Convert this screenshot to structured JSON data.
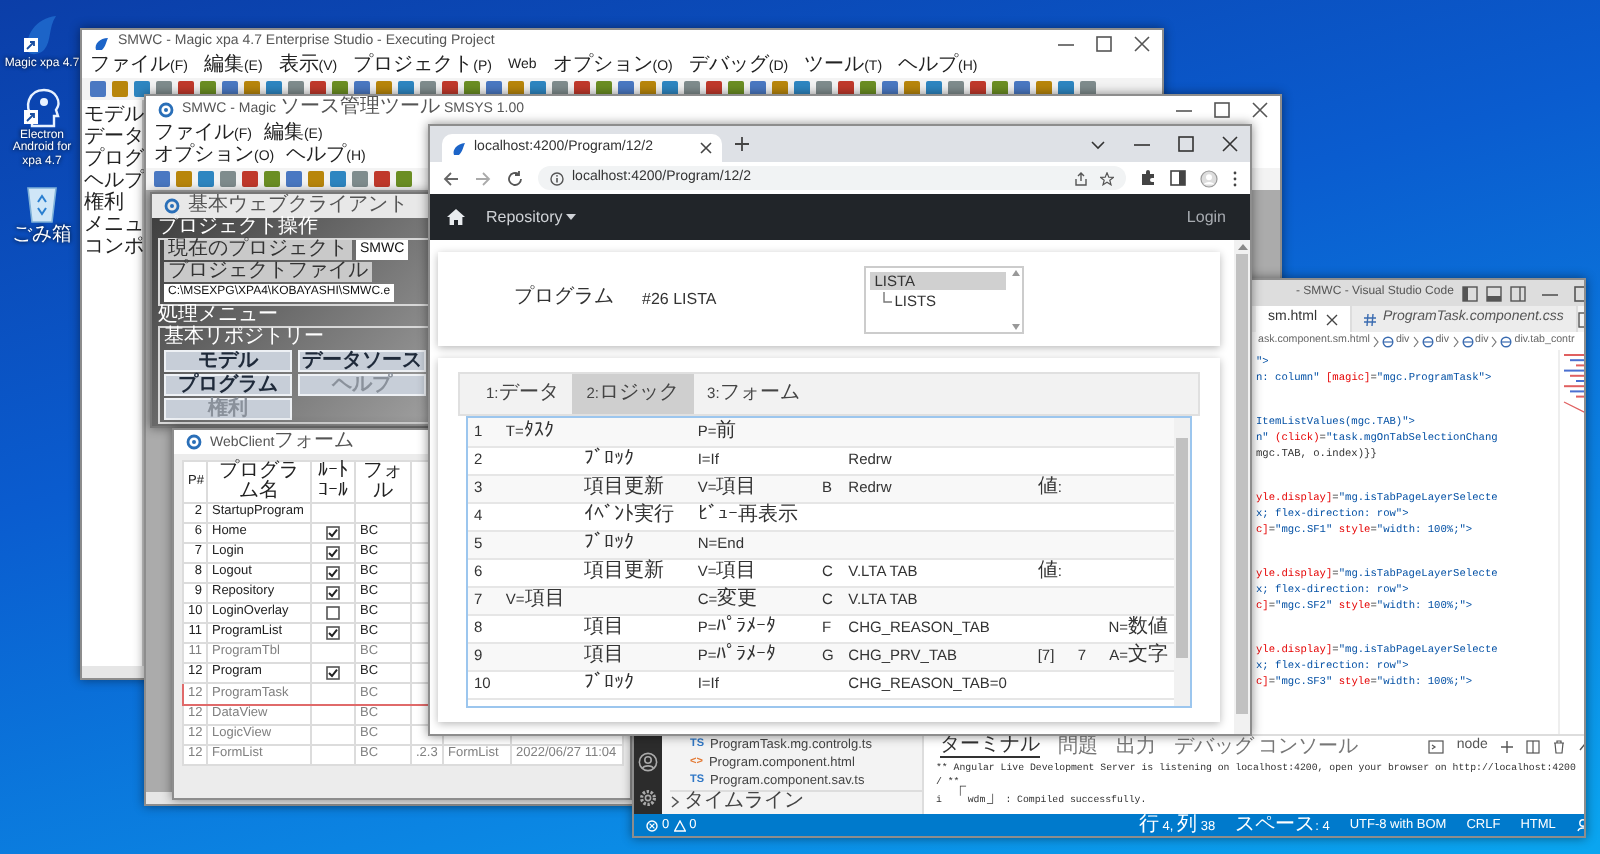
{
  "desktop_icons": [
    {
      "label": "Magic xpa 4.7",
      "kind": "app"
    },
    {
      "label": "Electron Android for xpa 4.7",
      "kind": "person"
    },
    {
      "label": "ごみ箱",
      "kind": "bin"
    }
  ],
  "magic_window": {
    "title": "SMWC - Magic xpa 4.7 Enterprise Studio - Executing Project",
    "menu": [
      "ファイル(F)",
      "編集(E)",
      "表示(V)",
      "プロジェクト(P)",
      "Web",
      "オプション(O)",
      "デバッグ(D)",
      "ツール(T)",
      "ヘルプ(H)"
    ],
    "tree_items": [
      "モデル",
      "データ",
      "プログ",
      "ヘルプ",
      "権利",
      "メニュ",
      "コンポ"
    ]
  },
  "smsys_window": {
    "title": "SMWC - Magic ソース管理ツール SMSYS 1.00",
    "menu": [
      "ファイル(F)",
      "編集(E)",
      "オプション(O)",
      "ヘルプ(H)"
    ]
  },
  "client_window": {
    "title": "基本ウェブクライアント",
    "project_group": {
      "legend": "プロジェクト操作",
      "fields": [
        {
          "label": "現在のプロジェクト",
          "value": "SMWC"
        },
        {
          "label": "プロジェクトファイル",
          "value": "C:\\MSEXPG\\XPA4\\KOBAYASHI\\SMWC.e"
        }
      ]
    },
    "menu_group": {
      "legend": "処理メニュー",
      "subgroup": {
        "legend": "基本リポジトリー",
        "buttons": [
          {
            "label": "モデル",
            "disabled": false
          },
          {
            "label": "データソース",
            "disabled": false
          },
          {
            "label": "プログラム",
            "disabled": false
          },
          {
            "label": "ヘルプ",
            "disabled": true
          },
          {
            "label": "権利",
            "disabled": true
          }
        ]
      }
    }
  },
  "webclient_form": {
    "title": "WebClientフォーム",
    "columns": [
      "P#",
      "プログラム名",
      "ﾙｰﾄｺｰﾙ",
      "フォル"
    ],
    "rows": [
      {
        "number": "2",
        "program": "StartupProgram",
        "disabled": false,
        "selected": false
      },
      {
        "number": "6",
        "program": "Home",
        "checked": true,
        "column_4": "BC",
        "disabled": false,
        "selected": false
      },
      {
        "number": "7",
        "program": "Login",
        "checked": true,
        "column_4": "BC",
        "disabled": false,
        "selected": false
      },
      {
        "number": "8",
        "program": "Logout",
        "checked": true,
        "column_4": "BC",
        "disabled": false,
        "selected": false
      },
      {
        "number": "9",
        "program": "Repository",
        "checked": true,
        "column_4": "BC",
        "disabled": false,
        "selected": false
      },
      {
        "number": "10",
        "program": "LoginOverlay",
        "checked": false,
        "column_4": "BC",
        "disabled": false,
        "selected": false
      },
      {
        "number": "11",
        "program": "ProgramList",
        "checked": true,
        "column_4": "BC",
        "disabled": false,
        "selected": false
      },
      {
        "number": "11",
        "program": "ProgramTbl",
        "column_4": "BC",
        "disabled": true,
        "selected": false
      },
      {
        "number": "12",
        "program": "Program",
        "checked": true,
        "column_4": "BC",
        "disabled": false,
        "selected": false
      },
      {
        "number": "12",
        "program": "ProgramTask",
        "column_4": "BC",
        "disabled": true,
        "selected": true
      },
      {
        "number": "12",
        "program": "DataView",
        "column_4": "BC",
        "disabled": true,
        "selected": false
      },
      {
        "number": "12",
        "program": "LogicView",
        "column_4": "BC",
        "disabled": true,
        "selected": false
      },
      {
        "number": "12",
        "program": "FormList",
        "column_4": "BC",
        "disabled": true,
        "selected": false,
        "extra": [
          ".2.3",
          "FormList",
          "2022/06/27 11:04"
        ]
      }
    ]
  },
  "browser": {
    "tab_title": "localhost:4200/Program/12/2",
    "url": "localhost:4200/Program/12/2",
    "nav": {
      "menu": "Repository",
      "login": "Login"
    },
    "program": {
      "label": "プログラム",
      "value": "#26 LISTA",
      "list": [
        {
          "label": "LISTA",
          "selected": true,
          "children": [
            {
              "label": "LISTS",
              "selected": false
            }
          ]
        }
      ]
    },
    "tabs": [
      {
        "label": "1:データ",
        "selected": false
      },
      {
        "label": "2:ロジック",
        "selected": true
      },
      {
        "label": "3:フォーム",
        "selected": false
      }
    ],
    "rows": [
      {
        "column_1": "1",
        "column_2": "T=ﾀｽｸ",
        "column_4": "P=前"
      },
      {
        "column_1": "2",
        "column_3": "ﾌﾞﾛｯｸ",
        "column_4": "I=If",
        "column_6": "Redrw"
      },
      {
        "column_1": "3",
        "column_3": "項目更新",
        "column_4": "V=項目",
        "column_5": "B",
        "column_6": "Redrw",
        "column_7": "値:"
      },
      {
        "column_1": "4",
        "column_3": "ｲﾍﾞﾝﾄ実行",
        "column_4": "ﾋﾞｭｰ再表示"
      },
      {
        "column_1": "5",
        "column_3": "ﾌﾞﾛｯｸ",
        "column_4": "N=End"
      },
      {
        "column_1": "6",
        "column_3": "項目更新",
        "column_4": "V=項目",
        "column_5": "C",
        "column_6": "V.LTA TAB",
        "column_7": "値:"
      },
      {
        "column_1": "7",
        "column_2": "V=項目",
        "column_4": "C=変更",
        "column_5": "C",
        "column_6": "V.LTA TAB"
      },
      {
        "column_1": "8",
        "column_3": "項目",
        "column_4": "P=ﾊﾟﾗﾒｰﾀ",
        "column_5": "F",
        "column_6": "CHG_REASON_TAB",
        "column_9": "N=数値"
      },
      {
        "column_1": "9",
        "column_3": "項目",
        "column_4": "P=ﾊﾟﾗﾒｰﾀ",
        "column_5": "G",
        "column_6": "CHG_PRV_TAB",
        "column_7": "[7]",
        "column_8": "7",
        "column_9": "A=文字"
      },
      {
        "column_1": "10",
        "column_3": "ﾌﾞﾛｯｸ",
        "column_4": "I=If",
        "column_6": "CHG_REASON_TAB=0"
      }
    ]
  },
  "vscode": {
    "title": "- SMWC - Visual Studio Code",
    "tabs": [
      {
        "label": "sm.html",
        "selected": true
      },
      {
        "label": "ProgramTask.component.css",
        "selected": false
      }
    ],
    "breadcrumb": [
      "ask.component.sm.html",
      "div",
      "div",
      "div",
      "div.tab_contr"
    ],
    "code_blocks": [
      {
        "lines": [
          [
            {
              "kind": "str",
              "text": "\">"
            }
          ],
          [
            {
              "kind": "str",
              "text": "n: column\""
            },
            {
              "kind": "attr",
              "text": " [magic]"
            },
            {
              "kind": "text",
              "text": "="
            },
            {
              "kind": "str",
              "text": "\"mgc.ProgramTask\">"
            }
          ]
        ]
      },
      {
        "lines": [
          [
            {
              "kind": "str",
              "text": "ItemListValues(mgc.TAB)\">"
            }
          ],
          [
            {
              "kind": "str",
              "text": "n\""
            },
            {
              "kind": "attr",
              "text": " (click)"
            },
            {
              "kind": "text",
              "text": "="
            },
            {
              "kind": "str",
              "text": "\"task.mgOnTabSelectionChang"
            }
          ],
          [
            {
              "kind": "text",
              "text": "mgc.TAB, o.index)}}"
            }
          ]
        ]
      },
      {
        "lines": [
          [
            {
              "kind": "attr",
              "text": "yle.display]"
            },
            {
              "kind": "text",
              "text": "="
            },
            {
              "kind": "str",
              "text": "\"mg.isTabPageLayerSelecte"
            }
          ],
          [
            {
              "kind": "str",
              "text": "x; flex-direction: row\">"
            }
          ],
          [
            {
              "kind": "attr",
              "text": "c]"
            },
            {
              "kind": "text",
              "text": "="
            },
            {
              "kind": "str",
              "text": "\"mgc.SF1\""
            },
            {
              "kind": "attr",
              "text": " style"
            },
            {
              "kind": "text",
              "text": "="
            },
            {
              "kind": "str",
              "text": "\"width: 100%;\">"
            }
          ]
        ]
      },
      {
        "lines": [
          [
            {
              "kind": "attr",
              "text": "yle.display]"
            },
            {
              "kind": "text",
              "text": "="
            },
            {
              "kind": "str",
              "text": "\"mg.isTabPageLayerSelecte"
            }
          ],
          [
            {
              "kind": "str",
              "text": "x; flex-direction: row\">"
            }
          ],
          [
            {
              "kind": "attr",
              "text": "c]"
            },
            {
              "kind": "text",
              "text": "="
            },
            {
              "kind": "str",
              "text": "\"mgc.SF2\""
            },
            {
              "kind": "attr",
              "text": " style"
            },
            {
              "kind": "text",
              "text": "="
            },
            {
              "kind": "str",
              "text": "\"width: 100%;\">"
            }
          ]
        ]
      },
      {
        "lines": [
          [
            {
              "kind": "attr",
              "text": "yle.display]"
            },
            {
              "kind": "text",
              "text": "="
            },
            {
              "kind": "str",
              "text": "\"mg.isTabPageLayerSelecte"
            }
          ],
          [
            {
              "kind": "str",
              "text": "x; flex-direction: row\">"
            }
          ],
          [
            {
              "kind": "attr",
              "text": "c]"
            },
            {
              "kind": "text",
              "text": "="
            },
            {
              "kind": "str",
              "text": "\"mgc.SF3\""
            },
            {
              "kind": "attr",
              "text": " style"
            },
            {
              "kind": "text",
              "text": "="
            },
            {
              "kind": "str",
              "text": "\"width: 100%;\">"
            }
          ]
        ]
      }
    ],
    "explorer": {
      "files": [
        {
          "name": "ProgramTask.mg.controlg.ts",
          "kind": "ts",
          "badge": "TS"
        },
        {
          "name": "Program.component.html",
          "kind": "html",
          "badge": "<>"
        },
        {
          "name": "Program.component.sav.ts",
          "kind": "ts",
          "badge": "TS"
        }
      ],
      "timeline": "タイムライン"
    },
    "panel": {
      "tabs": [
        {
          "label": "ターミナル",
          "selected": true
        },
        {
          "label": "問題",
          "selected": false
        },
        {
          "label": "出力",
          "selected": false
        },
        {
          "label": "デバッグ コンソール",
          "selected": false
        }
      ],
      "shell": "node",
      "terminal_lines": [
        "** Angular Live Development Server is listening on localhost:4200, open your browser on http://localhost:4200",
        "/ **",
        "i 「wdm」: Compiled successfully."
      ]
    },
    "status": {
      "errors": "0",
      "warnings": "0",
      "items": [
        "行 4, 列 38",
        "スペース: 4",
        "UTF-8 with BOM",
        "CRLF",
        "HTML"
      ]
    }
  }
}
